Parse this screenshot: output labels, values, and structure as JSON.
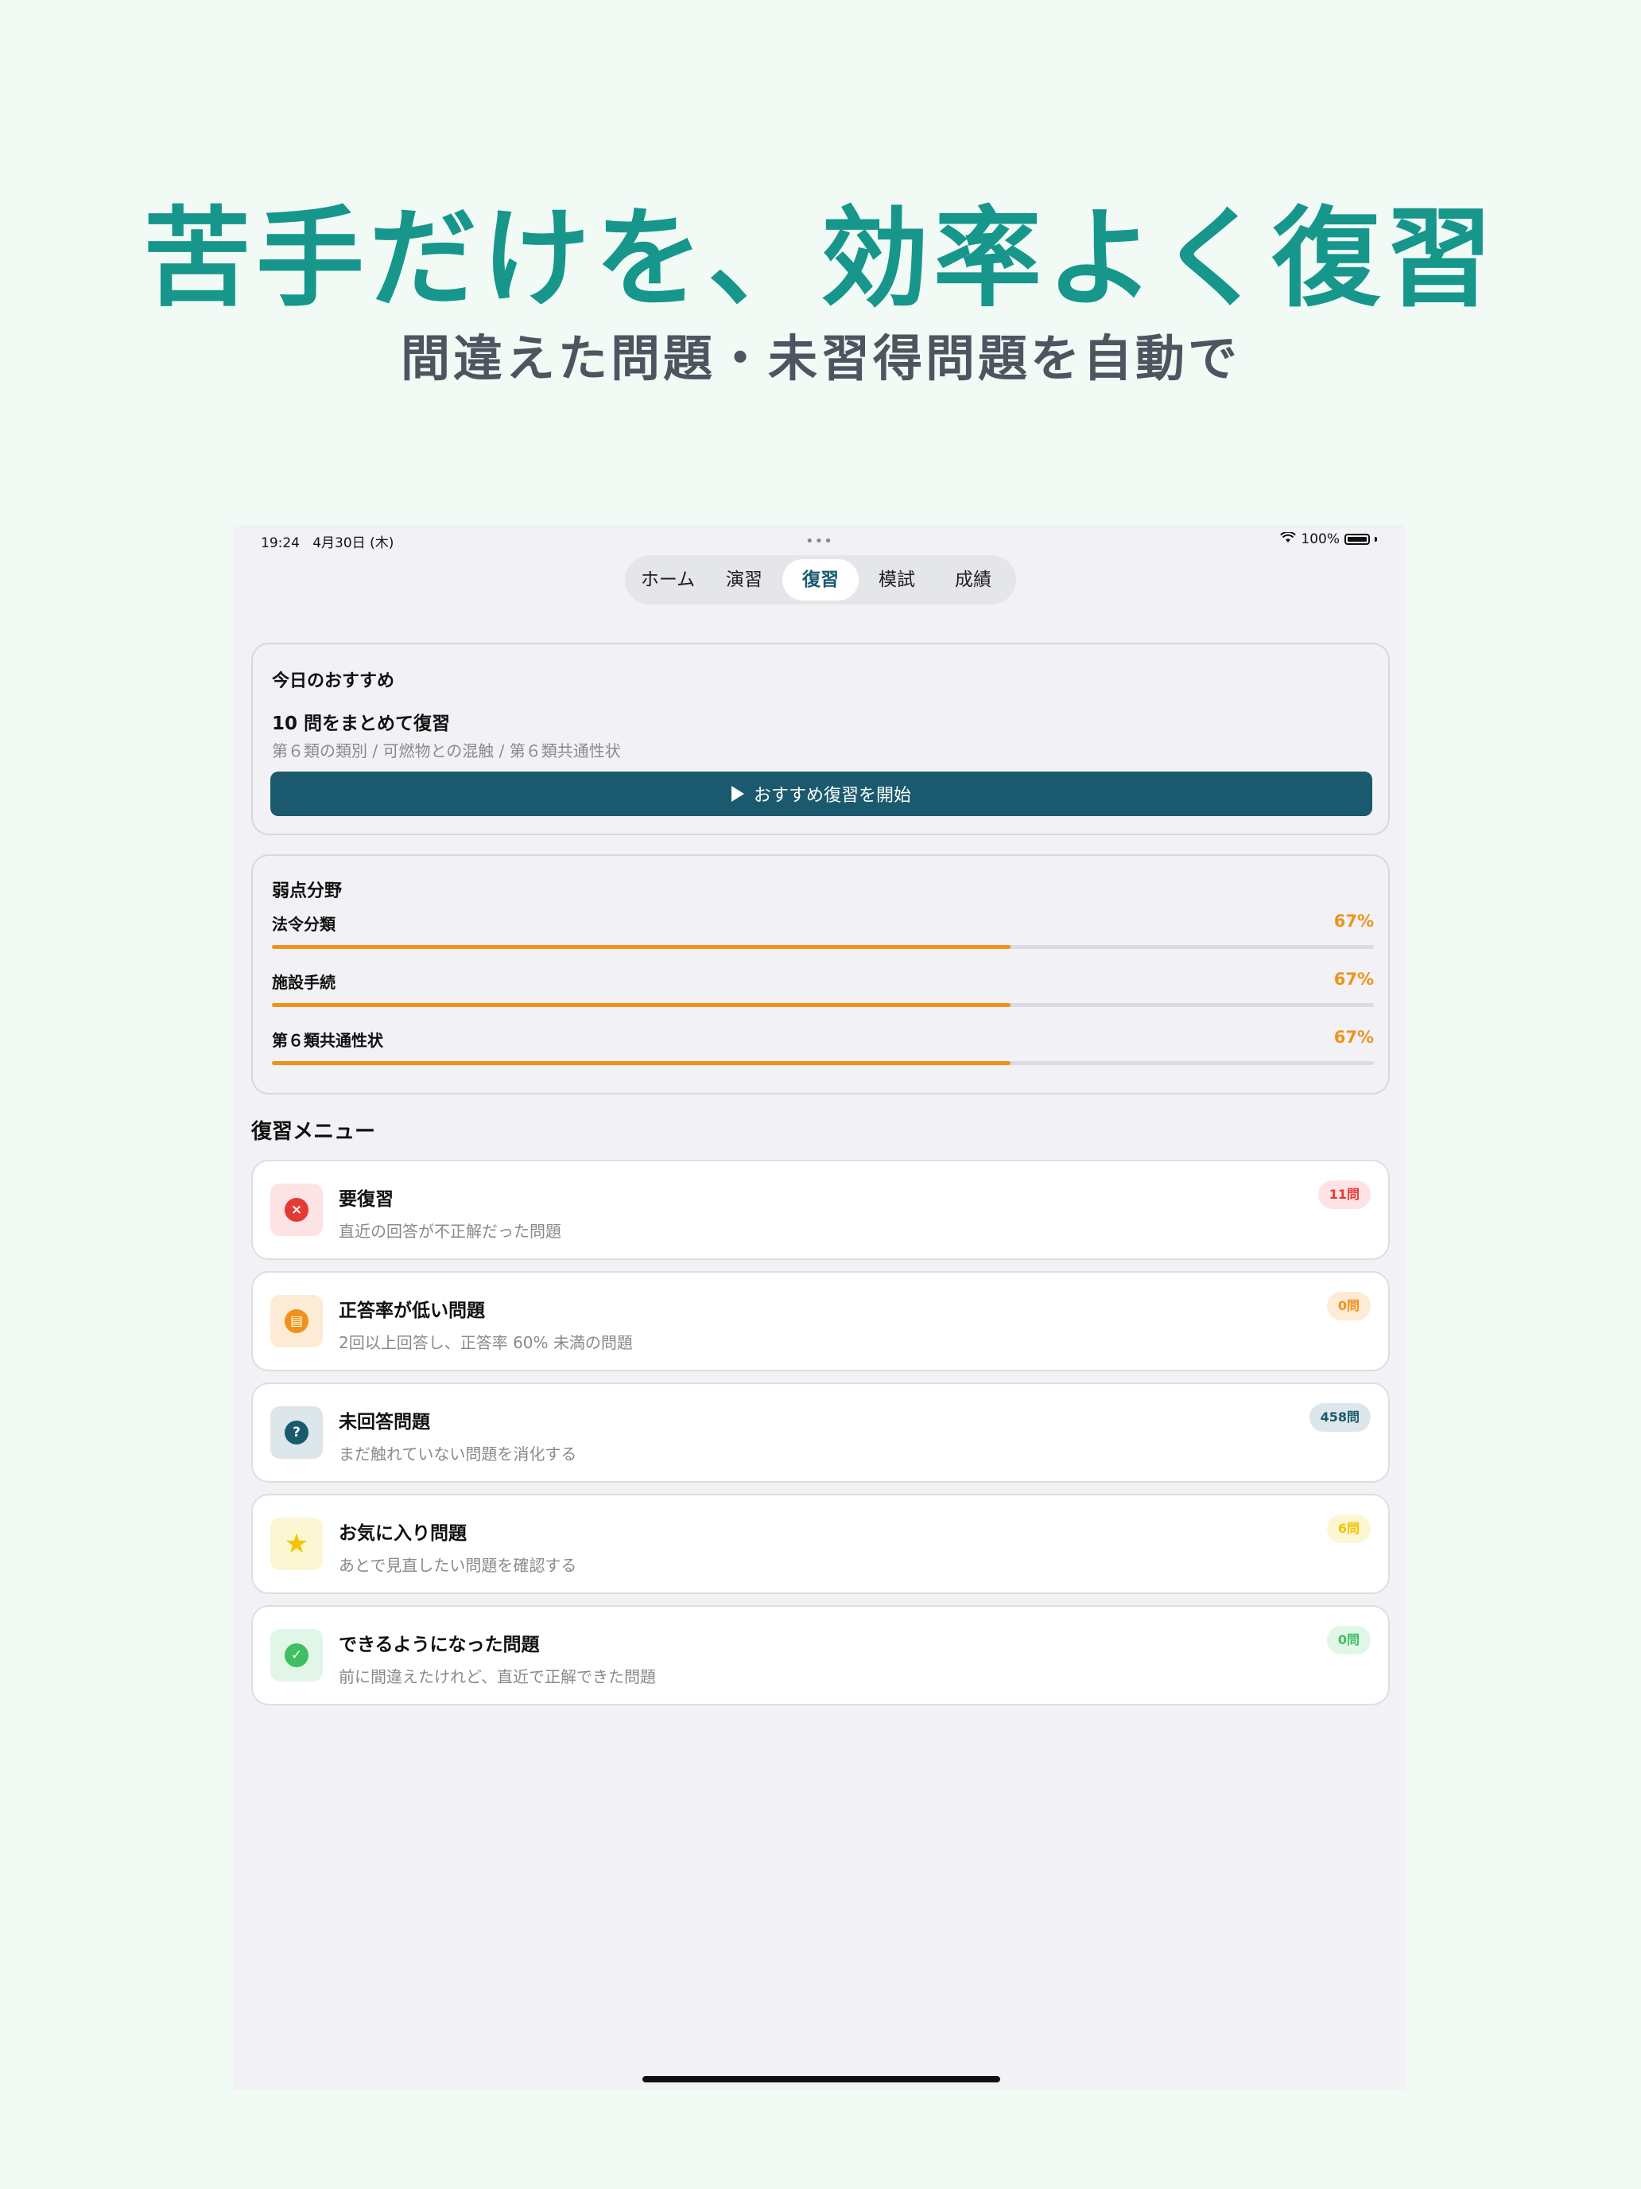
{
  "hero": {
    "title": "苦手だけを、効率よく復習",
    "subtitle": "間違えた問題・未習得問題を自動で"
  },
  "status_bar": {
    "time": "19:24",
    "date": "4月30日 (木)",
    "dots": "•••",
    "battery": "100%"
  },
  "tabs": [
    {
      "label": "ホーム",
      "active": false
    },
    {
      "label": "演習",
      "active": false
    },
    {
      "label": "復習",
      "active": true
    },
    {
      "label": "模試",
      "active": false
    },
    {
      "label": "成績",
      "active": false
    }
  ],
  "recommend": {
    "heading": "今日のおすすめ",
    "title": "10 問をまとめて復習",
    "subtitle": "第６類の類別 / 可燃物との混触 / 第６類共通性状",
    "button_label": "おすすめ復習を開始"
  },
  "weak_fields": {
    "heading": "弱点分野",
    "items": [
      {
        "name": "法令分類",
        "percent": "67%",
        "value": 0.67
      },
      {
        "name": "施設手続",
        "percent": "67%",
        "value": 0.67
      },
      {
        "name": "第６類共通性状",
        "percent": "67%",
        "value": 0.67
      }
    ]
  },
  "review_menu": {
    "heading": "復習メニュー",
    "items": [
      {
        "title": "要復習",
        "desc": "直近の回答が不正解だった問題",
        "badge": "11問",
        "icon": "x-circle-icon",
        "glyph": "×",
        "accent": "#e53935",
        "tint": "#fde3e3"
      },
      {
        "title": "正答率が低い問題",
        "desc": "2回以上回答し、正答率 60% 未満の問題",
        "badge": "0問",
        "icon": "chart-down-icon",
        "glyph": "▤",
        "accent": "#f0921a",
        "tint": "#fdebd6"
      },
      {
        "title": "未回答問題",
        "desc": "まだ触れていない問題を消化する",
        "badge": "458問",
        "icon": "question-circle-icon",
        "glyph": "?",
        "accent": "#1b5a6e",
        "tint": "#dde6ea"
      },
      {
        "title": "お気に入り問題",
        "desc": "あとで見直したい問題を確認する",
        "badge": "6問",
        "icon": "star-icon",
        "glyph": "★",
        "accent": "#f5c400",
        "tint": "#fdf6d3"
      },
      {
        "title": "できるようになった問題",
        "desc": "前に間違えたけれど、直近で正解できた問題",
        "badge": "0問",
        "icon": "check-seal-icon",
        "glyph": "✓",
        "accent": "#3fbf62",
        "tint": "#e2f6e7"
      }
    ]
  }
}
